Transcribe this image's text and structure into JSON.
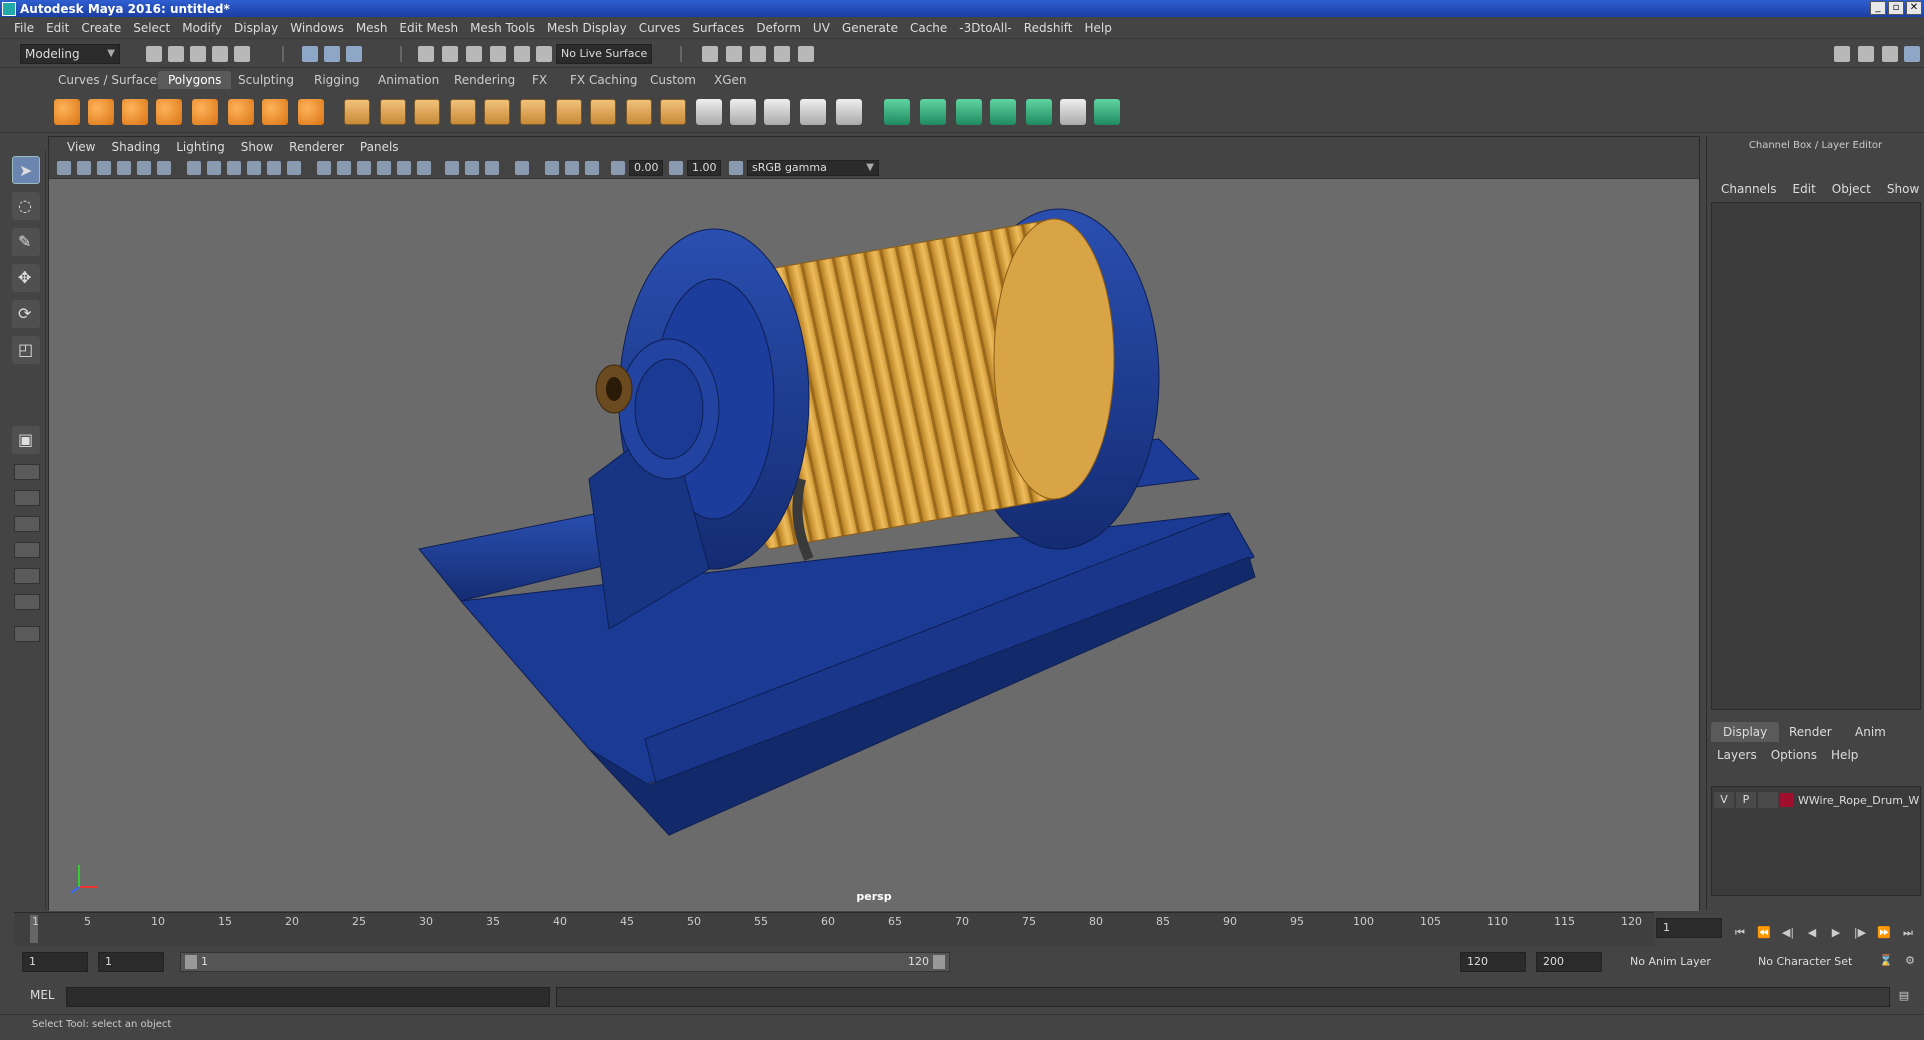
{
  "window": {
    "title": "Autodesk Maya 2016: untitled*",
    "min": "_",
    "max": "▫",
    "close": "✕"
  },
  "menus": [
    "File",
    "Edit",
    "Create",
    "Select",
    "Modify",
    "Display",
    "Windows",
    "Mesh",
    "Edit Mesh",
    "Mesh Tools",
    "Mesh Display",
    "Curves",
    "Surfaces",
    "Deform",
    "UV",
    "Generate",
    "Cache",
    "-3DtoAll-",
    "Redshift",
    "Help"
  ],
  "status": {
    "mode": "Modeling",
    "live_surface": "No Live Surface"
  },
  "shelf": {
    "tabs": [
      "Curves / Surfaces",
      "Polygons",
      "Sculpting",
      "Rigging",
      "Animation",
      "Rendering",
      "FX",
      "FX Caching",
      "Custom",
      "XGen"
    ],
    "active_tab": "Polygons"
  },
  "panel": {
    "menus": [
      "View",
      "Shading",
      "Lighting",
      "Show",
      "Renderer",
      "Panels"
    ],
    "exposure": "0.00",
    "gamma": "1.00",
    "color_space": "sRGB gamma",
    "camera": "persp"
  },
  "channel_box": {
    "title": "Channel Box / Layer Editor",
    "menus": [
      "Channels",
      "Edit",
      "Object",
      "Show"
    ]
  },
  "layer_editor": {
    "tabs": [
      "Display",
      "Render",
      "Anim"
    ],
    "active_tab": "Display",
    "menus": [
      "Layers",
      "Options",
      "Help"
    ],
    "layers": [
      {
        "v": "V",
        "p": "P",
        "name": "WWire_Rope_Drum_W",
        "color": "#a0102c"
      }
    ]
  },
  "timeline": {
    "ticks": [
      "5",
      "10",
      "15",
      "20",
      "25",
      "30",
      "35",
      "40",
      "45",
      "50",
      "55",
      "60",
      "65",
      "70",
      "75",
      "80",
      "85",
      "90",
      "95",
      "100",
      "105",
      "110",
      "115",
      "120"
    ],
    "start_label": "1",
    "current_frame": "1"
  },
  "range": {
    "start": "1",
    "playback_start": "1",
    "bar_start": "1",
    "bar_end": "120",
    "playback_end": "120",
    "end": "200",
    "anim_layer": "No Anim Layer",
    "character_set": "No Character Set"
  },
  "command": {
    "label": "MEL"
  },
  "help_line": "Select Tool: select an object",
  "colors": {
    "drum_blue": "#1a3a8f",
    "rope_yellow": "#e0a83a"
  }
}
